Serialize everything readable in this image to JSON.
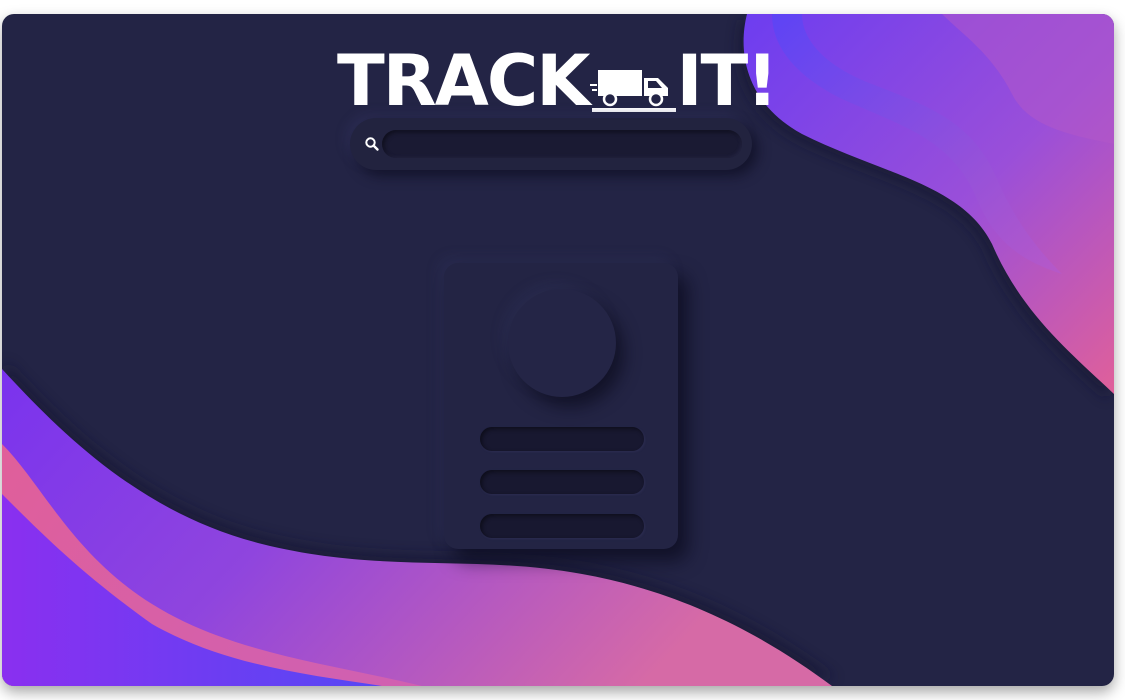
{
  "app": {
    "logo_left": "TRACK",
    "logo_right": "IT!",
    "logo_icon": "delivery-truck-icon"
  },
  "search": {
    "icon": "search-icon",
    "value": "",
    "placeholder": ""
  },
  "profile_card": {
    "avatar_icon": "avatar-placeholder",
    "placeholder_lines": 3
  },
  "colors": {
    "background": "#232445",
    "accent_purple": "#7b3ff2",
    "accent_blue": "#5a48f5",
    "accent_pink": "#e0609a",
    "text": "#ffffff"
  }
}
